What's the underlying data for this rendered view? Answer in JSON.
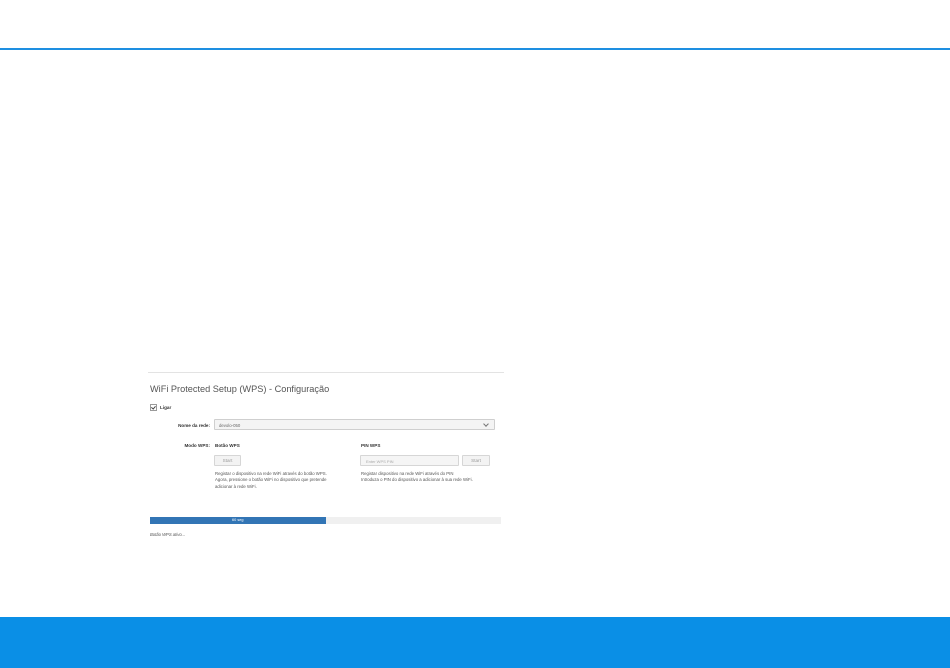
{
  "wps": {
    "title": "WiFi Protected Setup (WPS) - Configuração",
    "enable_label": "Ligar",
    "enabled": true,
    "network_label": "Nome da rede:",
    "network_value": "devolo-050",
    "mode_label": "Modo WPS:",
    "button_mode": {
      "heading": "Botão WPS",
      "start_label": "Start",
      "description_lines": [
        "Registar o dispositivo na rede WiFi através do botão WPS.",
        "Agora, pressione o botão WiFi no dispositivo que pretende adicionar à rede WiFi."
      ]
    },
    "pin_mode": {
      "heading": "PIN WPS",
      "pin_placeholder": "Enter WPS PIN",
      "start_label": "Start",
      "description_lines": [
        "Registar dispositivo na rede WiFi através do PIN",
        "Introduza o PIN do dispositivo a adicionar à sua rede WiFi."
      ]
    },
    "progress": {
      "label": "60 seg",
      "fraction": 0.5
    },
    "status": "Botão WPS ativo..."
  },
  "colors": {
    "accent": "#1e8fe1",
    "footer": "#0a8fe6",
    "progress_fill": "#3275b5"
  }
}
